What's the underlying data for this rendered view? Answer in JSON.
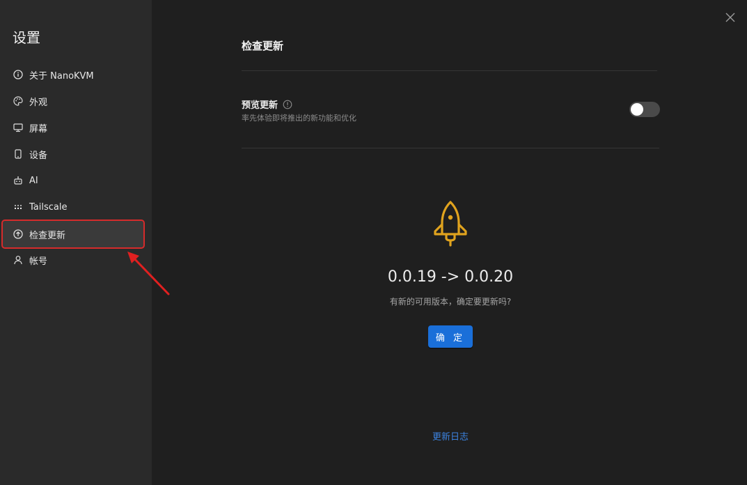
{
  "sidebar": {
    "title": "设置",
    "items": [
      {
        "label": "关于 NanoKVM",
        "icon": "info-circle-icon"
      },
      {
        "label": "外观",
        "icon": "palette-icon"
      },
      {
        "label": "屏幕",
        "icon": "monitor-icon"
      },
      {
        "label": "设备",
        "icon": "phone-icon"
      },
      {
        "label": "AI",
        "icon": "robot-icon"
      },
      {
        "label": "Tailscale",
        "icon": "tailscale-dots-icon"
      },
      {
        "label": "检查更新",
        "icon": "arrow-up-circle-icon",
        "active": true
      },
      {
        "label": "帐号",
        "icon": "user-icon"
      }
    ]
  },
  "main": {
    "title": "检查更新",
    "preview": {
      "label": "预览更新",
      "description": "率先体验即将推出的新功能和优化",
      "enabled": false
    },
    "version_text": "0.0.19 -> 0.0.20",
    "prompt": "有新的可用版本，确定要更新吗?",
    "confirm_label": "确 定",
    "changelog_label": "更新日志"
  },
  "colors": {
    "accent": "#1a6fd9",
    "rocket": "#e0a31e",
    "link": "#3c83e0",
    "highlight_box": "#d62b2b"
  }
}
